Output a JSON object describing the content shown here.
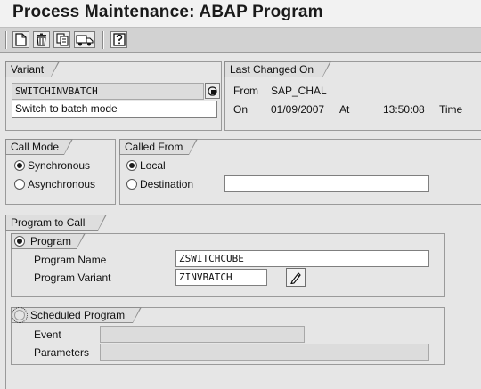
{
  "window": {
    "title": "Process Maintenance: ABAP Program"
  },
  "toolbar": {
    "icons": [
      "new-document-icon",
      "delete-icon",
      "copy-icon",
      "transport-truck-icon",
      "help-icon"
    ]
  },
  "variant": {
    "tab_label": "Variant",
    "name_value": "SWITCHINVBATCH",
    "description_value": "Switch to batch mode"
  },
  "last_changed": {
    "tab_label": "Last Changed On",
    "from_label": "From",
    "from_value": "SAP_CHAL",
    "on_label": "On",
    "date_value": "01/09/2007",
    "at_label": "At",
    "time_value": "13:50:08",
    "time_label": "Time"
  },
  "call_mode": {
    "tab_label": "Call Mode",
    "synchronous_label": "Synchronous",
    "asynchronous_label": "Asynchronous",
    "selected": "Synchronous"
  },
  "called_from": {
    "tab_label": "Called From",
    "local_label": "Local",
    "destination_label": "Destination",
    "destination_value": "",
    "selected": "Local"
  },
  "program_to_call": {
    "tab_label": "Program to Call",
    "program": {
      "tab_label": "Program",
      "selected": true,
      "name_label": "Program Name",
      "name_value": "ZSWITCHCUBE",
      "variant_label": "Program Variant",
      "variant_value": "ZINVBATCH"
    },
    "scheduled": {
      "tab_label": "Scheduled Program",
      "selected": false,
      "event_label": "Event",
      "event_value": "",
      "parameters_label": "Parameters",
      "parameters_value": ""
    }
  }
}
